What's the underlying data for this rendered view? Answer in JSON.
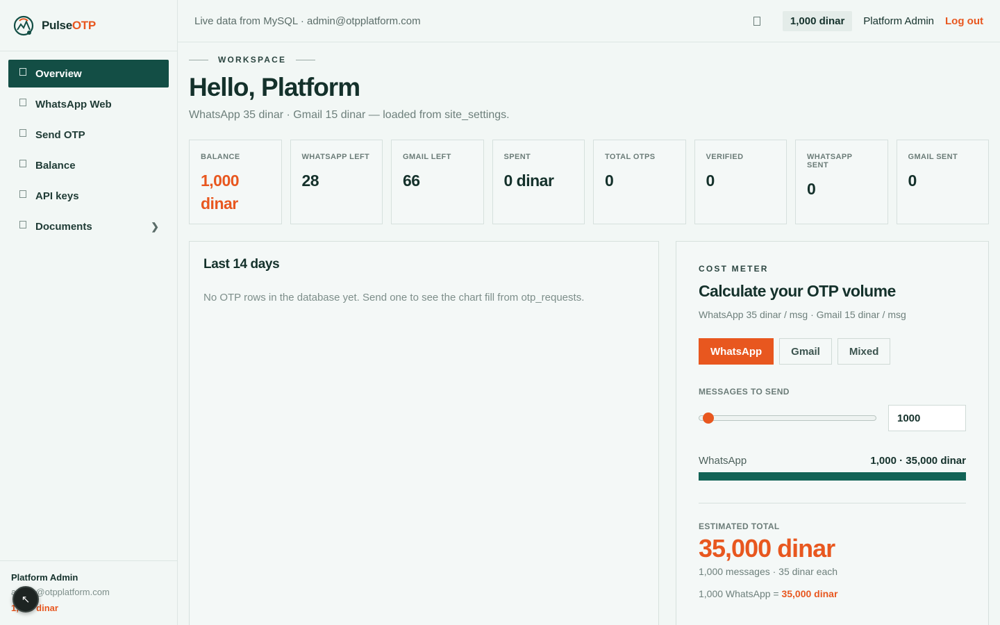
{
  "brand": {
    "name_main": "Pulse",
    "name_accent": "OTP"
  },
  "sidebar": {
    "items": [
      {
        "label": "Overview",
        "active": true
      },
      {
        "label": "WhatsApp Web"
      },
      {
        "label": "Send OTP"
      },
      {
        "label": "Balance"
      },
      {
        "label": "API keys"
      },
      {
        "label": "Documents",
        "has_children": true
      }
    ],
    "footer": {
      "name": "Platform Admin",
      "email": "admin@otpplatform.com",
      "balance": "1,000 dinar"
    }
  },
  "topbar": {
    "live_text": "Live data from MySQL · admin@otpplatform.com",
    "balance": "1,000 dinar",
    "admin_name": "Platform Admin",
    "logout": "Log out"
  },
  "page": {
    "eyebrow": "WORKSPACE",
    "title": "Hello, Platform",
    "subtitle": "WhatsApp 35 dinar · Gmail 15 dinar — loaded from site_settings."
  },
  "stats": [
    {
      "label": "BALANCE",
      "value": "1,000 dinar",
      "accent": true
    },
    {
      "label": "WHATSAPP LEFT",
      "value": "28"
    },
    {
      "label": "GMAIL LEFT",
      "value": "66"
    },
    {
      "label": "SPENT",
      "value": "0 dinar"
    },
    {
      "label": "TOTAL OTPS",
      "value": "0"
    },
    {
      "label": "VERIFIED",
      "value": "0"
    },
    {
      "label": "WHATSAPP SENT",
      "value": "0"
    },
    {
      "label": "GMAIL SENT",
      "value": "0"
    }
  ],
  "chart_card": {
    "title": "Last 14 days",
    "empty_text": "No OTP rows in the database yet. Send one to see the chart fill from otp_requests."
  },
  "cost_meter": {
    "eyebrow": "COST METER",
    "title": "Calculate your OTP volume",
    "rates": "WhatsApp 35 dinar / msg · Gmail 15 dinar / msg",
    "modes": [
      "WhatsApp",
      "Gmail",
      "Mixed"
    ],
    "active_mode": 0,
    "messages_label": "MESSAGES TO SEND",
    "messages_value": "1000",
    "slider_fraction": 0.02,
    "breakdown_label": "WhatsApp",
    "breakdown_value": "1,000 · 35,000 dinar",
    "breakdown_fraction": 1.0,
    "estimated_label": "ESTIMATED TOTAL",
    "estimated_value": "35,000 dinar",
    "estimated_sub": "1,000 messages · 35 dinar each",
    "formula_prefix": "1,000 WhatsApp = ",
    "formula_total": "35,000 dinar"
  },
  "colors": {
    "accent": "#e8571f",
    "primary": "#134e45",
    "bar": "#126356"
  },
  "icons": {
    "nav": "square-icon",
    "bell": "bell-icon",
    "chevron": "chevron-right-icon",
    "fab": "cursor-icon"
  }
}
